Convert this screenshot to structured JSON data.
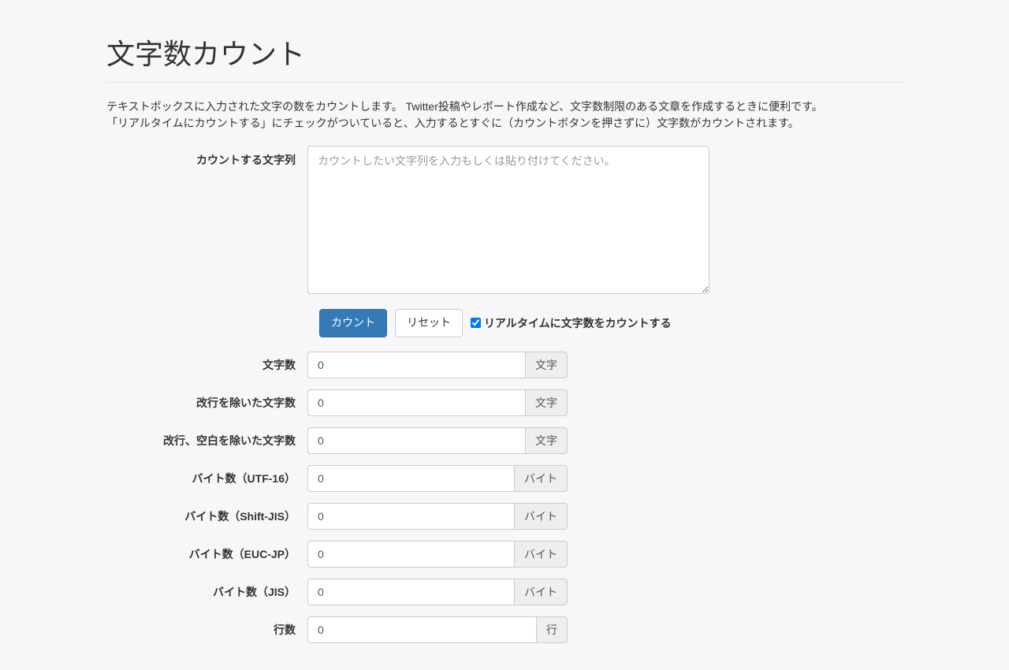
{
  "page": {
    "title": "文字数カウント",
    "description_line1": "テキストボックスに入力された文字の数をカウントします。 Twitter投稿やレポート作成など、文字数制限のある文章を作成するときに便利です。",
    "description_line2": "「リアルタイムにカウントする」にチェックがついていると、入力するとすぐに（カウントボタンを押さずに）文字数がカウントされます。"
  },
  "form": {
    "textarea_label": "カウントする文字列",
    "textarea_placeholder": "カウントしたい文字列を入力もしくは貼り付けてください。",
    "count_button": "カウント",
    "reset_button": "リセット",
    "realtime_checkbox_label": "リアルタイムに文字数をカウントする"
  },
  "results": [
    {
      "label": "文字数",
      "value": "0",
      "unit": "文字"
    },
    {
      "label": "改行を除いた文字数",
      "value": "0",
      "unit": "文字"
    },
    {
      "label": "改行、空白を除いた文字数",
      "value": "0",
      "unit": "文字"
    },
    {
      "label": "バイト数（UTF-16）",
      "value": "0",
      "unit": "バイト"
    },
    {
      "label": "バイト数（Shift-JIS）",
      "value": "0",
      "unit": "バイト"
    },
    {
      "label": "バイト数（EUC-JP）",
      "value": "0",
      "unit": "バイト"
    },
    {
      "label": "バイト数（JIS）",
      "value": "0",
      "unit": "バイト"
    },
    {
      "label": "行数",
      "value": "0",
      "unit": "行"
    }
  ]
}
